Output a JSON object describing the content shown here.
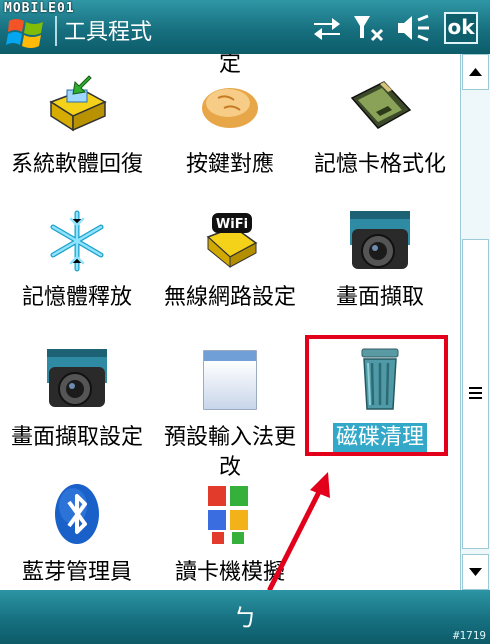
{
  "watermark": "MOBILE01",
  "title": "工具程式",
  "titlebar": {
    "ok_label": "ok"
  },
  "apps": [
    {
      "id": "system-software-rollback",
      "label": "系統軟體回復",
      "icon": "software-box-icon"
    },
    {
      "id": "button-mapping",
      "label": "按鍵對應",
      "icon": "bread-icon"
    },
    {
      "id": "memory-card-format",
      "label": "記憶卡格式化",
      "icon": "memory-card-icon"
    },
    {
      "id": "memory-release",
      "label": "記憶體釋放",
      "icon": "snowflake-icon"
    },
    {
      "id": "wifi-settings",
      "label": "無線網路設定",
      "icon": "wifi-device-icon"
    },
    {
      "id": "screen-capture",
      "label": "畫面擷取",
      "icon": "camera-icon"
    },
    {
      "id": "screen-capture-settings",
      "label": "畫面擷取設定",
      "icon": "camera-icon"
    },
    {
      "id": "default-input-change",
      "label": "預設輸入法更改",
      "icon": "window-icon"
    },
    {
      "id": "disk-cleanup",
      "label": "磁碟清理",
      "icon": "trash-can-icon",
      "selected": true
    },
    {
      "id": "bluetooth-manager",
      "label": "藍芽管理員",
      "icon": "bluetooth-icon"
    },
    {
      "id": "card-reader-mode",
      "label": "讀卡機模擬",
      "icon": "color-blocks-icon"
    }
  ],
  "top_partial_label": "定",
  "bottombar": {
    "softkey": "ㄅ",
    "photo_id": "#1719"
  },
  "colors": {
    "title_bar": "#17707f",
    "highlight": "#e2001b",
    "selection": "#33a8c8"
  }
}
